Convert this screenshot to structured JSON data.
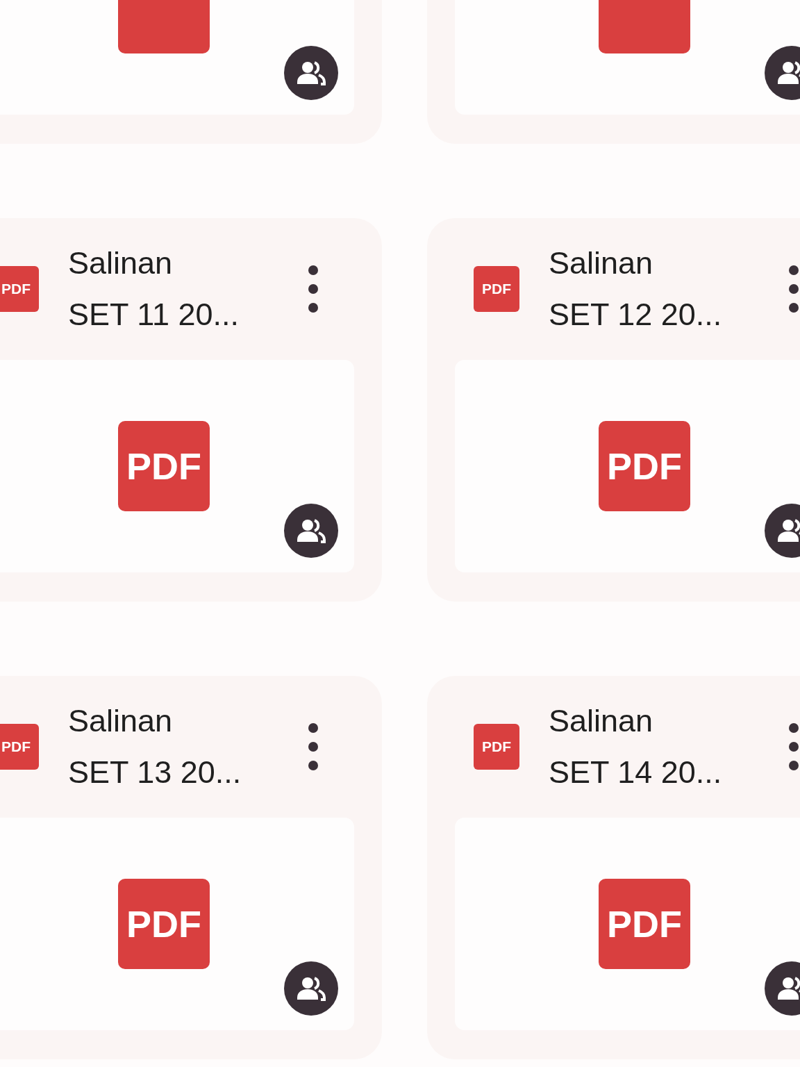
{
  "files": [
    {
      "shared": true
    },
    {
      "shared": true
    },
    {
      "icon_label": "PDF",
      "name": "Salinan\nSET 11 20...",
      "preview_label": "PDF",
      "shared": true
    },
    {
      "icon_label": "PDF",
      "name": "Salinan\nSET 12 20...",
      "preview_label": "PDF",
      "shared": true
    },
    {
      "icon_label": "PDF",
      "name": "Salinan\nSET 13 20...",
      "preview_label": "PDF",
      "shared": true
    },
    {
      "icon_label": "PDF",
      "name": "Salinan\nSET 14 20...",
      "preview_label": "PDF",
      "shared": true
    }
  ]
}
